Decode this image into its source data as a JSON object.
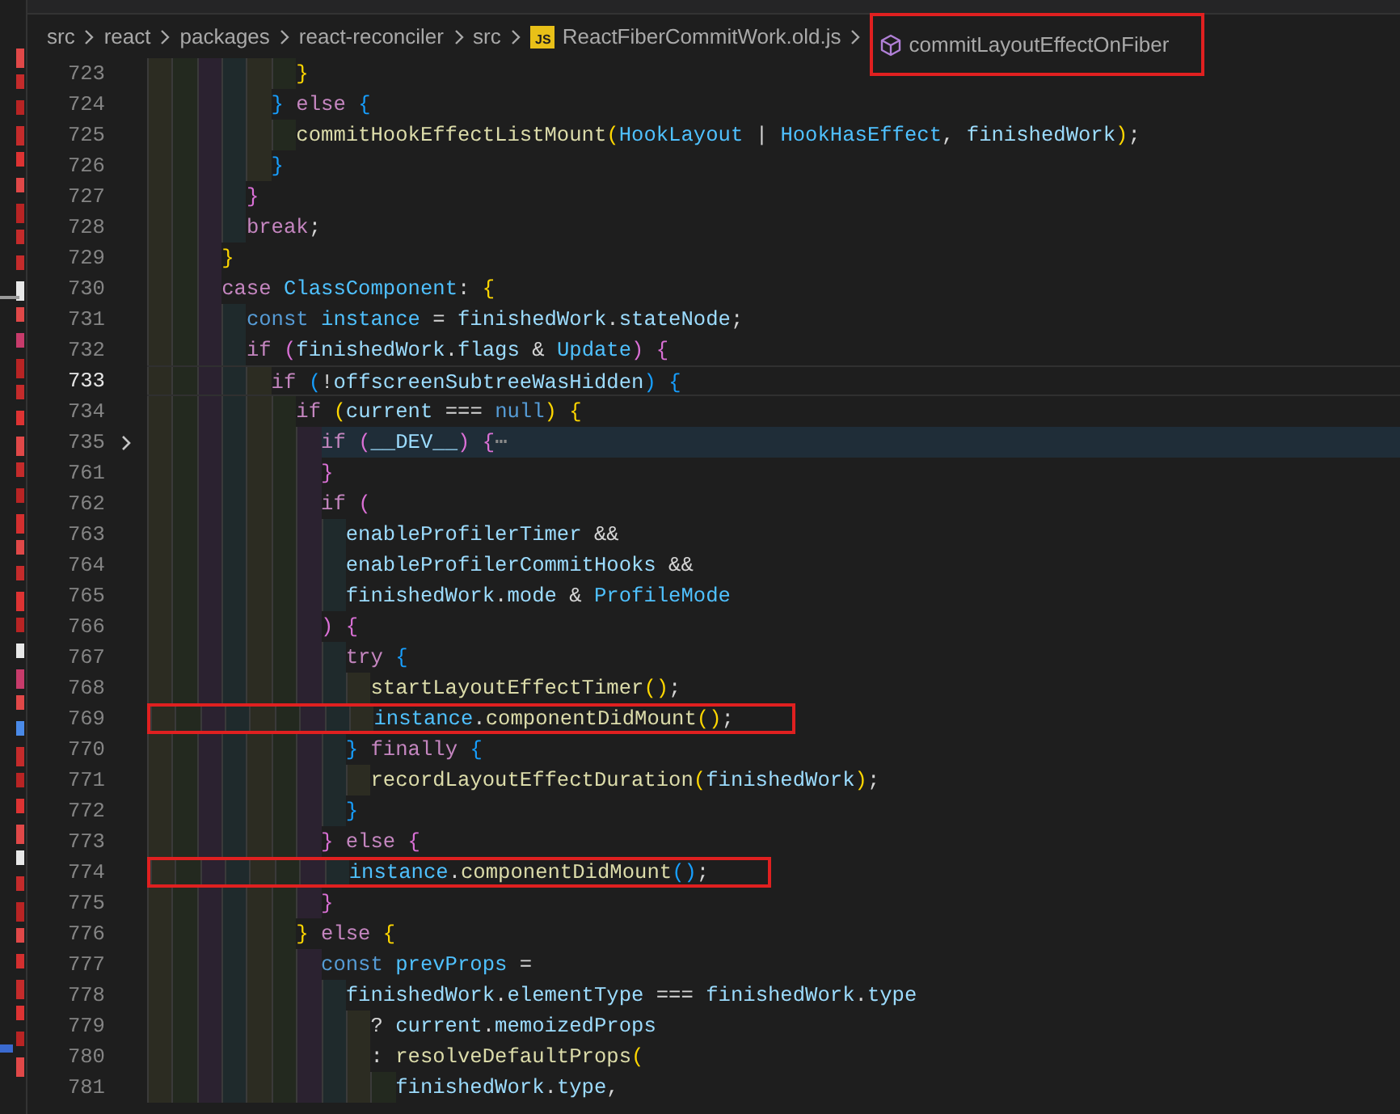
{
  "breadcrumb": [
    {
      "kind": "folder",
      "label": "src",
      "boxed": false
    },
    {
      "kind": "folder",
      "label": "react",
      "boxed": false
    },
    {
      "kind": "folder",
      "label": "packages",
      "boxed": false
    },
    {
      "kind": "folder",
      "label": "react-reconciler",
      "boxed": false
    },
    {
      "kind": "folder",
      "label": "src",
      "boxed": false
    },
    {
      "kind": "file",
      "label": "ReactFiberCommitWork.old.js",
      "badge": "JS",
      "boxed": false
    },
    {
      "kind": "symbol",
      "label": "commitLayoutEffectOnFiber",
      "boxed": true
    }
  ],
  "editor": {
    "lines": [
      {
        "number": "723",
        "active": false,
        "folded": false,
        "boxed": false,
        "tokens": [
          {
            "text": "            }",
            "kind": "b1"
          }
        ]
      },
      {
        "number": "724",
        "active": false,
        "folded": false,
        "boxed": false,
        "tokens": [
          {
            "text": "          }",
            "kind": "b3"
          },
          {
            "text": " else ",
            "kind": "kw"
          },
          {
            "text": "{",
            "kind": "b3"
          }
        ]
      },
      {
        "number": "725",
        "active": false,
        "folded": false,
        "boxed": false,
        "tokens": [
          {
            "text": "            commitHookEffectListMount",
            "kind": "fn"
          },
          {
            "text": "(",
            "kind": "b1"
          },
          {
            "text": "HookLayout",
            "kind": "co"
          },
          {
            "text": " | ",
            "kind": "pl"
          },
          {
            "text": "HookHasEffect",
            "kind": "co"
          },
          {
            "text": ", ",
            "kind": "pl"
          },
          {
            "text": "finishedWork",
            "kind": "va"
          },
          {
            "text": ")",
            "kind": "b1"
          },
          {
            "text": ";",
            "kind": "pl"
          }
        ]
      },
      {
        "number": "726",
        "active": false,
        "folded": false,
        "boxed": false,
        "tokens": [
          {
            "text": "          }",
            "kind": "b3"
          }
        ]
      },
      {
        "number": "727",
        "active": false,
        "folded": false,
        "boxed": false,
        "tokens": [
          {
            "text": "        }",
            "kind": "b2"
          }
        ]
      },
      {
        "number": "728",
        "active": false,
        "folded": false,
        "boxed": false,
        "tokens": [
          {
            "text": "        break",
            "kind": "kw"
          },
          {
            "text": ";",
            "kind": "pl"
          }
        ]
      },
      {
        "number": "729",
        "active": false,
        "folded": false,
        "boxed": false,
        "tokens": [
          {
            "text": "      }",
            "kind": "b1"
          }
        ]
      },
      {
        "number": "730",
        "active": false,
        "folded": false,
        "boxed": false,
        "tokens": [
          {
            "text": "      case ",
            "kind": "kw"
          },
          {
            "text": "ClassComponent",
            "kind": "co"
          },
          {
            "text": ": ",
            "kind": "pl"
          },
          {
            "text": "{",
            "kind": "b1"
          }
        ]
      },
      {
        "number": "731",
        "active": false,
        "folded": false,
        "boxed": false,
        "tokens": [
          {
            "text": "        const ",
            "kind": "st"
          },
          {
            "text": "instance",
            "kind": "co"
          },
          {
            "text": " = ",
            "kind": "pl"
          },
          {
            "text": "finishedWork",
            "kind": "va"
          },
          {
            "text": ".",
            "kind": "pl"
          },
          {
            "text": "stateNode",
            "kind": "va"
          },
          {
            "text": ";",
            "kind": "pl"
          }
        ]
      },
      {
        "number": "732",
        "active": false,
        "folded": false,
        "boxed": false,
        "tokens": [
          {
            "text": "        if ",
            "kind": "kw"
          },
          {
            "text": "(",
            "kind": "b2"
          },
          {
            "text": "finishedWork",
            "kind": "va"
          },
          {
            "text": ".",
            "kind": "pl"
          },
          {
            "text": "flags",
            "kind": "va"
          },
          {
            "text": " & ",
            "kind": "pl"
          },
          {
            "text": "Update",
            "kind": "co"
          },
          {
            "text": ")",
            "kind": "b2"
          },
          {
            "text": " {",
            "kind": "b2"
          }
        ]
      },
      {
        "number": "733",
        "active": true,
        "folded": false,
        "boxed": false,
        "tokens": [
          {
            "text": "          if ",
            "kind": "kw"
          },
          {
            "text": "(",
            "kind": "b3"
          },
          {
            "text": "!",
            "kind": "pl"
          },
          {
            "text": "offscreenSubtreeWasHidden",
            "kind": "va"
          },
          {
            "text": ")",
            "kind": "b3"
          },
          {
            "text": " {",
            "kind": "b3"
          }
        ]
      },
      {
        "number": "734",
        "active": false,
        "folded": false,
        "boxed": false,
        "tokens": [
          {
            "text": "            if ",
            "kind": "kw"
          },
          {
            "text": "(",
            "kind": "b1"
          },
          {
            "text": "current",
            "kind": "va"
          },
          {
            "text": " === ",
            "kind": "pl"
          },
          {
            "text": "null",
            "kind": "st"
          },
          {
            "text": ")",
            "kind": "b1"
          },
          {
            "text": " {",
            "kind": "b1"
          }
        ]
      },
      {
        "number": "735",
        "active": false,
        "folded": true,
        "boxed": false,
        "tokens": [
          {
            "text": "              if ",
            "kind": "kw"
          },
          {
            "text": "(",
            "kind": "b2"
          },
          {
            "text": "__DEV__",
            "kind": "va"
          },
          {
            "text": ")",
            "kind": "b2"
          },
          {
            "text": " {",
            "kind": "b2"
          },
          {
            "text": "⋯",
            "kind": "fold"
          }
        ]
      },
      {
        "number": "761",
        "active": false,
        "folded": false,
        "boxed": false,
        "tokens": [
          {
            "text": "              }",
            "kind": "b2"
          }
        ]
      },
      {
        "number": "762",
        "active": false,
        "folded": false,
        "boxed": false,
        "tokens": [
          {
            "text": "              if ",
            "kind": "kw"
          },
          {
            "text": "(",
            "kind": "b2"
          }
        ]
      },
      {
        "number": "763",
        "active": false,
        "folded": false,
        "boxed": false,
        "tokens": [
          {
            "text": "                enableProfilerTimer",
            "kind": "va"
          },
          {
            "text": " &&",
            "kind": "pl"
          }
        ]
      },
      {
        "number": "764",
        "active": false,
        "folded": false,
        "boxed": false,
        "tokens": [
          {
            "text": "                enableProfilerCommitHooks",
            "kind": "va"
          },
          {
            "text": " &&",
            "kind": "pl"
          }
        ]
      },
      {
        "number": "765",
        "active": false,
        "folded": false,
        "boxed": false,
        "tokens": [
          {
            "text": "                finishedWork",
            "kind": "va"
          },
          {
            "text": ".",
            "kind": "pl"
          },
          {
            "text": "mode",
            "kind": "va"
          },
          {
            "text": " & ",
            "kind": "pl"
          },
          {
            "text": "ProfileMode",
            "kind": "co"
          }
        ]
      },
      {
        "number": "766",
        "active": false,
        "folded": false,
        "boxed": false,
        "tokens": [
          {
            "text": "              ) {",
            "kind": "b2"
          }
        ]
      },
      {
        "number": "767",
        "active": false,
        "folded": false,
        "boxed": false,
        "tokens": [
          {
            "text": "                try ",
            "kind": "kw"
          },
          {
            "text": "{",
            "kind": "b3"
          }
        ]
      },
      {
        "number": "768",
        "active": false,
        "folded": false,
        "boxed": false,
        "tokens": [
          {
            "text": "                  startLayoutEffectTimer",
            "kind": "fn"
          },
          {
            "text": "()",
            "kind": "b1"
          },
          {
            "text": ";",
            "kind": "pl"
          }
        ]
      },
      {
        "number": "769",
        "active": false,
        "folded": false,
        "boxed": true,
        "tokens": [
          {
            "text": "                  instance",
            "kind": "co"
          },
          {
            "text": ".",
            "kind": "pl"
          },
          {
            "text": "componentDidMount",
            "kind": "fn"
          },
          {
            "text": "()",
            "kind": "b1"
          },
          {
            "text": ";",
            "kind": "pl"
          }
        ]
      },
      {
        "number": "770",
        "active": false,
        "folded": false,
        "boxed": false,
        "tokens": [
          {
            "text": "                }",
            "kind": "b3"
          },
          {
            "text": " finally ",
            "kind": "kw"
          },
          {
            "text": "{",
            "kind": "b3"
          }
        ]
      },
      {
        "number": "771",
        "active": false,
        "folded": false,
        "boxed": false,
        "tokens": [
          {
            "text": "                  recordLayoutEffectDuration",
            "kind": "fn"
          },
          {
            "text": "(",
            "kind": "b1"
          },
          {
            "text": "finishedWork",
            "kind": "va"
          },
          {
            "text": ")",
            "kind": "b1"
          },
          {
            "text": ";",
            "kind": "pl"
          }
        ]
      },
      {
        "number": "772",
        "active": false,
        "folded": false,
        "boxed": false,
        "tokens": [
          {
            "text": "                }",
            "kind": "b3"
          }
        ]
      },
      {
        "number": "773",
        "active": false,
        "folded": false,
        "boxed": false,
        "tokens": [
          {
            "text": "              }",
            "kind": "b2"
          },
          {
            "text": " else ",
            "kind": "kw"
          },
          {
            "text": "{",
            "kind": "b2"
          }
        ]
      },
      {
        "number": "774",
        "active": false,
        "folded": false,
        "boxed": true,
        "tokens": [
          {
            "text": "                instance",
            "kind": "co"
          },
          {
            "text": ".",
            "kind": "pl"
          },
          {
            "text": "componentDidMount",
            "kind": "fn"
          },
          {
            "text": "()",
            "kind": "b3"
          },
          {
            "text": ";",
            "kind": "pl"
          }
        ]
      },
      {
        "number": "775",
        "active": false,
        "folded": false,
        "boxed": false,
        "tokens": [
          {
            "text": "              }",
            "kind": "b2"
          }
        ]
      },
      {
        "number": "776",
        "active": false,
        "folded": false,
        "boxed": false,
        "tokens": [
          {
            "text": "            }",
            "kind": "b1"
          },
          {
            "text": " else ",
            "kind": "kw"
          },
          {
            "text": "{",
            "kind": "b1"
          }
        ]
      },
      {
        "number": "777",
        "active": false,
        "folded": false,
        "boxed": false,
        "tokens": [
          {
            "text": "              const ",
            "kind": "st"
          },
          {
            "text": "prevProps",
            "kind": "co"
          },
          {
            "text": " =",
            "kind": "pl"
          }
        ]
      },
      {
        "number": "778",
        "active": false,
        "folded": false,
        "boxed": false,
        "tokens": [
          {
            "text": "                finishedWork",
            "kind": "va"
          },
          {
            "text": ".",
            "kind": "pl"
          },
          {
            "text": "elementType",
            "kind": "va"
          },
          {
            "text": " === ",
            "kind": "pl"
          },
          {
            "text": "finishedWork",
            "kind": "va"
          },
          {
            "text": ".",
            "kind": "pl"
          },
          {
            "text": "type",
            "kind": "va"
          }
        ]
      },
      {
        "number": "779",
        "active": false,
        "folded": false,
        "boxed": false,
        "tokens": [
          {
            "text": "                  ? ",
            "kind": "pl"
          },
          {
            "text": "current",
            "kind": "va"
          },
          {
            "text": ".",
            "kind": "pl"
          },
          {
            "text": "memoizedProps",
            "kind": "va"
          }
        ]
      },
      {
        "number": "780",
        "active": false,
        "folded": false,
        "boxed": false,
        "tokens": [
          {
            "text": "                  : ",
            "kind": "pl"
          },
          {
            "text": "resolveDefaultProps",
            "kind": "fn"
          },
          {
            "text": "(",
            "kind": "b1"
          }
        ]
      },
      {
        "number": "781",
        "active": false,
        "folded": false,
        "boxed": false,
        "tokens": [
          {
            "text": "                    finishedWork",
            "kind": "va"
          },
          {
            "text": ".",
            "kind": "pl"
          },
          {
            "text": "type",
            "kind": "va"
          },
          {
            "text": ",",
            "kind": "pl"
          }
        ]
      }
    ]
  }
}
